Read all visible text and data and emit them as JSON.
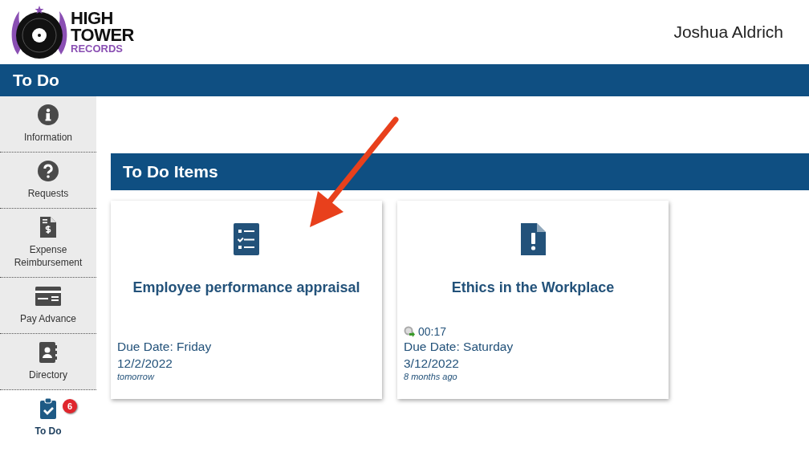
{
  "header": {
    "logo_lines": [
      "HIGH",
      "TOWER",
      "RECORDS"
    ],
    "user_name": "Joshua Aldrich"
  },
  "page_title": "To Do",
  "sidebar": {
    "items": [
      {
        "label": "Information",
        "kind": "info",
        "selected": false
      },
      {
        "label": "Requests",
        "kind": "question",
        "selected": false
      },
      {
        "label": "Expense Reimbursement",
        "kind": "receipt",
        "selected": false
      },
      {
        "label": "Pay Advance",
        "kind": "card",
        "selected": false
      },
      {
        "label": "Directory",
        "kind": "contact",
        "selected": false
      },
      {
        "label": "To Do",
        "kind": "clipboard",
        "selected": true,
        "badge": "6"
      }
    ]
  },
  "section_title": "To Do Items",
  "cards": [
    {
      "kind": "checklist",
      "title": "Employee performance appraisal",
      "due": "Due Date: Friday",
      "date": "12/2/2022",
      "relative": "tomorrow"
    },
    {
      "kind": "alert",
      "title": "Ethics in the Workplace",
      "timer": "00:17",
      "due": "Due Date: Saturday",
      "date": "3/12/2022",
      "relative": "8 months ago"
    }
  ]
}
